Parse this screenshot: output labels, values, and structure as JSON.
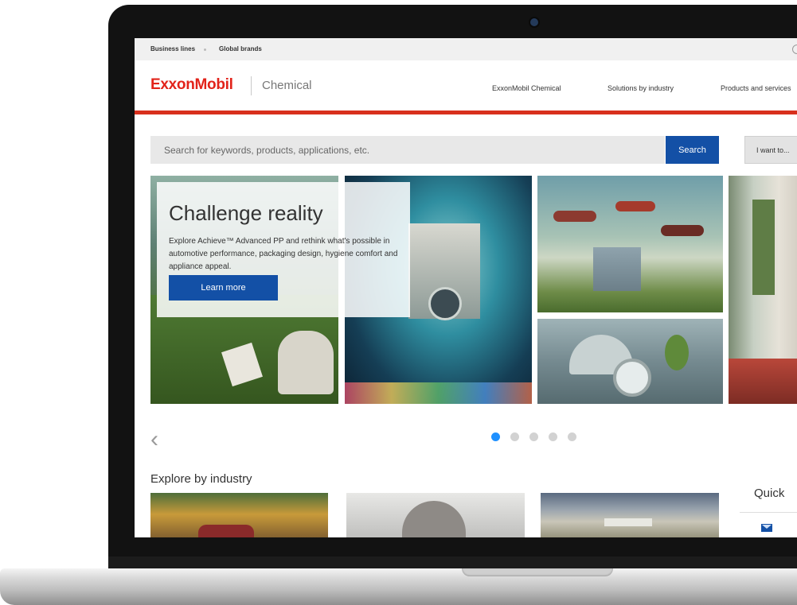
{
  "topbar": {
    "links": [
      "Business lines",
      "Global brands"
    ]
  },
  "header": {
    "logo": "ExxonMobil",
    "logo_sub": "Chemical",
    "nav": [
      "ExxonMobil Chemical",
      "Solutions by industry",
      "Products and services"
    ]
  },
  "search": {
    "placeholder": "Search for keywords, products, applications, etc.",
    "button": "Search",
    "i_want": "I want to..."
  },
  "hero": {
    "title": "Challenge reality",
    "text": "Explore Achieve™ Advanced PP and rethink what's possible in automotive performance, packaging design, hygiene comfort and appliance appeal.",
    "button": "Learn more"
  },
  "carousel": {
    "prev_icon": "chevron-left-icon",
    "slide_count": 5,
    "active_slide": 1
  },
  "explore": {
    "title": "Explore by industry"
  },
  "quick": {
    "title": "Quick",
    "icon": "mail-icon"
  },
  "colors": {
    "brand_red": "#e2231a",
    "accent_blue": "#1350a6",
    "dot_active": "#1e90ff"
  }
}
